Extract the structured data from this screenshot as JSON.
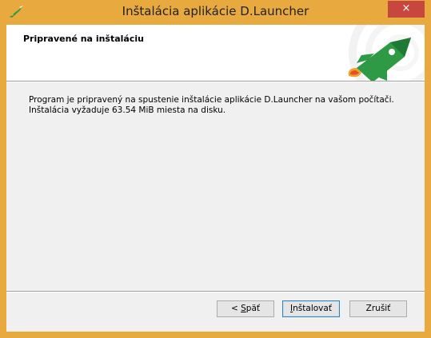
{
  "window": {
    "title": "Inštalácia aplikácie D.Launcher",
    "close_label": "×"
  },
  "header": {
    "title": "Pripravené na inštaláciu"
  },
  "body": {
    "line1": "Program je pripravený na spustenie inštalácie aplikácie D.Launcher na vašom počítači.",
    "line2": "Inštalácia vyžaduje 63.54 MiB miesta na disku."
  },
  "buttons": {
    "back_prefix": "< ",
    "back_mnemonic": "S",
    "back_rest": "päť",
    "install_mnemonic": "I",
    "install_rest": "nštalovať",
    "cancel": "Zrušiť"
  },
  "colors": {
    "titlebar": "#e8a93e",
    "close": "#c7463e",
    "rocket_green": "#2e9a46"
  }
}
